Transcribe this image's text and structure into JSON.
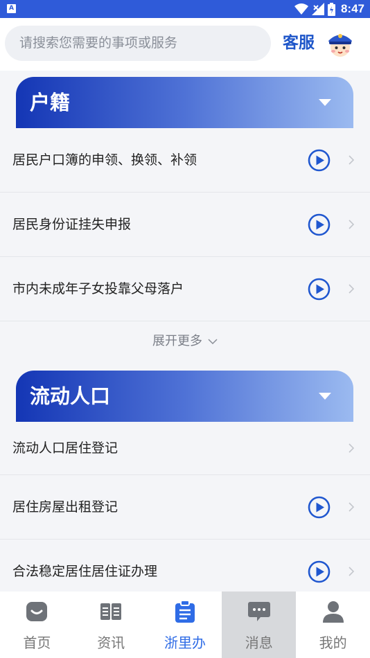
{
  "status_bar": {
    "app_badge": "A",
    "time": "8:47"
  },
  "search": {
    "placeholder": "请搜索您需要的事项或服务"
  },
  "header": {
    "service_label": "客服"
  },
  "sections": [
    {
      "title": "户籍",
      "items": [
        {
          "label": "居民户口簿的申领、换领、补领",
          "has_video": true
        },
        {
          "label": "居民身份证挂失申报",
          "has_video": true
        },
        {
          "label": "市内未成年子女投靠父母落户",
          "has_video": true
        }
      ],
      "expand_label": "展开更多"
    },
    {
      "title": "流动人口",
      "items": [
        {
          "label": "流动人口居住登记",
          "has_video": false
        },
        {
          "label": "居住房屋出租登记",
          "has_video": true
        },
        {
          "label": "合法稳定居住居住证办理",
          "has_video": true
        }
      ]
    }
  ],
  "tabs": [
    {
      "label": "首页",
      "icon": "home-icon",
      "selected": false
    },
    {
      "label": "资讯",
      "icon": "news-book-icon",
      "selected": false
    },
    {
      "label": "浙里办",
      "icon": "clipboard-icon",
      "selected": true
    },
    {
      "label": "消息",
      "icon": "message-bubble-icon",
      "selected": false
    },
    {
      "label": "我的",
      "icon": "user-icon",
      "selected": false
    }
  ],
  "colors": {
    "accent": "#2f6ce6",
    "status_bar": "#2f5bd9",
    "header_gradient_start": "#1436b5",
    "header_gradient_end": "#9bbaf0",
    "tab_inactive": "#777777"
  }
}
